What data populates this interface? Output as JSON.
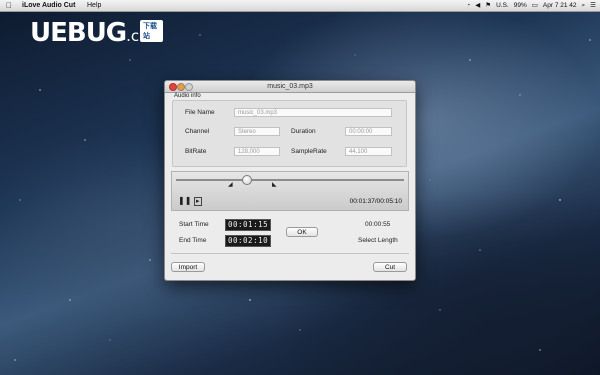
{
  "menubar": {
    "app_name": "iLove Audio Cut",
    "help_menu": "Help",
    "status": {
      "language": "U.S.",
      "battery": "99%",
      "clock": "Apr 7  21 42"
    }
  },
  "watermark": {
    "brand": "UEBUG",
    "suffix": ".com",
    "badge": "下载站"
  },
  "window": {
    "title": "music_03.mp3",
    "audio_info": {
      "group_label": "Audio info",
      "file_name_label": "File Name",
      "file_name_value": "music_03.mp3",
      "channel_label": "Channel",
      "channel_value": "Stereo",
      "duration_label": "Duration",
      "duration_value": "00:00:00",
      "bitrate_label": "BitRate",
      "bitrate_value": "128,000",
      "samplerate_label": "SampleRate",
      "samplerate_value": "44,100"
    },
    "player": {
      "time_readout": "00:01:37/00:05:10",
      "position_fraction": 0.31
    },
    "times": {
      "start_label": "Start Time",
      "start_value": "00:01:15",
      "end_label": "End Time",
      "end_value": "00:02:10",
      "ok_label": "OK",
      "selection_length": "00:00:55",
      "select_length_label": "Select Length"
    },
    "import_label": "Import",
    "cut_label": "Cut"
  }
}
